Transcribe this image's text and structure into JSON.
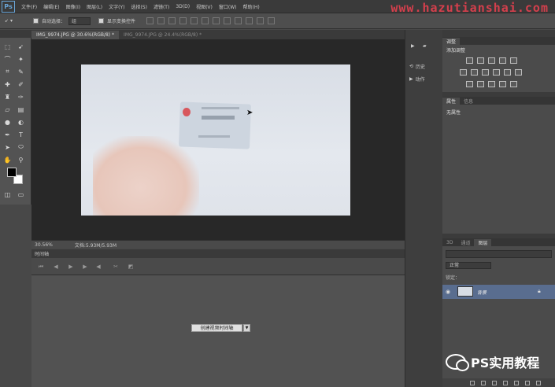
{
  "menubar": {
    "logo": "Ps",
    "items": [
      "文件(F)",
      "编辑(E)",
      "图像(I)",
      "图层(L)",
      "文字(Y)",
      "选择(S)",
      "滤镜(T)",
      "3D(D)",
      "视图(V)",
      "窗口(W)",
      "帮助(H)"
    ],
    "watermark": "www.hazutianshai.com"
  },
  "options": {
    "auto_select_label": "自动选择：",
    "auto_select_value": "组",
    "show_transform_label": "显示变换控件"
  },
  "document": {
    "tabs": [
      "IMG_9974.JPG @ 30.6%(RGB/8) *",
      "IMG_9974.JPG @ 24.4%(RGB/8) *"
    ],
    "zoom": "30.56%",
    "doc_info": "文档:5.93M/5.93M"
  },
  "timeline": {
    "title": "时间轴",
    "create_button": "创建视频时间轴"
  },
  "mini_dock": {
    "items": [
      "",
      "",
      "历史",
      "动作"
    ]
  },
  "adjustments": {
    "tabs": [
      "调整"
    ],
    "title": "添加调整"
  },
  "properties": {
    "tabs": [
      "属性",
      "信息"
    ],
    "text": "无属性"
  },
  "layers": {
    "tabs": [
      "3D",
      "通道",
      "图层"
    ],
    "mode": "正常",
    "lock_label": "锁定：",
    "layer_name": "背景"
  },
  "watermark_bottom": {
    "text": "PS实用教程"
  }
}
